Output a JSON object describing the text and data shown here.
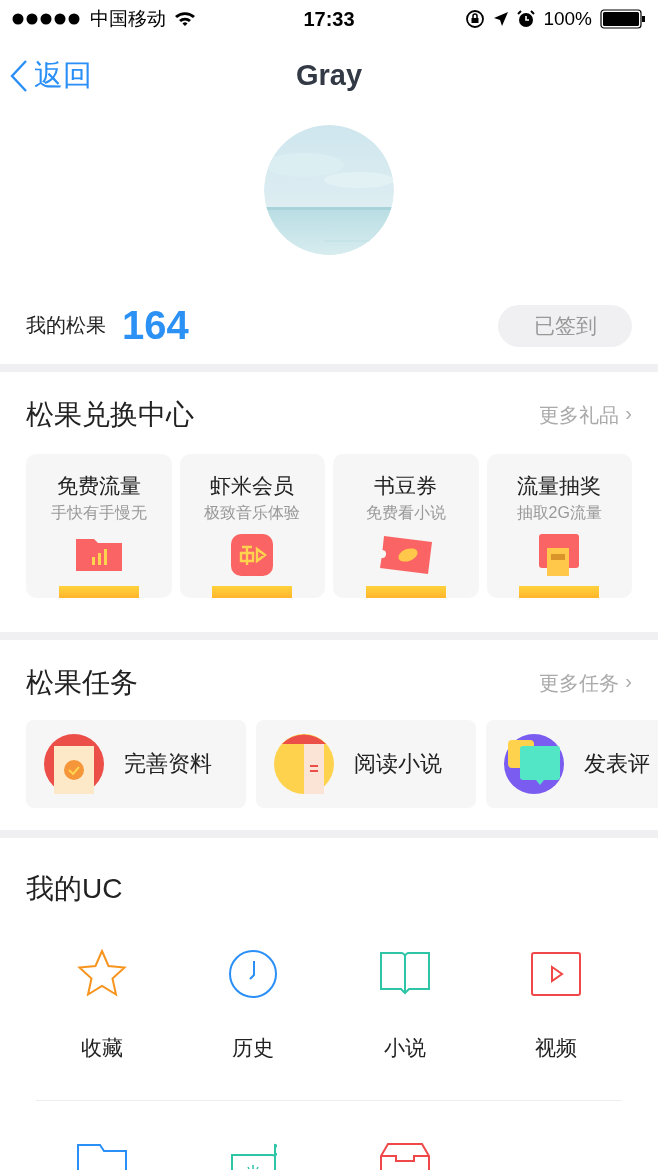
{
  "status_bar": {
    "carrier": "中国移动",
    "time": "17:33",
    "battery": "100%"
  },
  "nav": {
    "back": "返回",
    "title": "Gray"
  },
  "profile": {
    "points_label": "我的松果",
    "points": "164",
    "sign_button": "已签到"
  },
  "exchange": {
    "title": "松果兑换中心",
    "more": "更多礼品",
    "more_arrow": "›",
    "cards": [
      {
        "title": "免费流量",
        "subtitle": "手快有手慢无"
      },
      {
        "title": "虾米会员",
        "subtitle": "极致音乐体验"
      },
      {
        "title": "书豆券",
        "subtitle": "免费看小说"
      },
      {
        "title": "流量抽奖",
        "subtitle": "抽取2G流量"
      }
    ]
  },
  "tasks": {
    "title": "松果任务",
    "more": "更多任务",
    "more_arrow": "›",
    "items": [
      {
        "label": "完善资料"
      },
      {
        "label": "阅读小说"
      },
      {
        "label": "发表评"
      }
    ]
  },
  "uc": {
    "title": "我的UC",
    "items": [
      {
        "label": "收藏"
      },
      {
        "label": "历史"
      },
      {
        "label": "小说"
      },
      {
        "label": "视频"
      }
    ]
  }
}
